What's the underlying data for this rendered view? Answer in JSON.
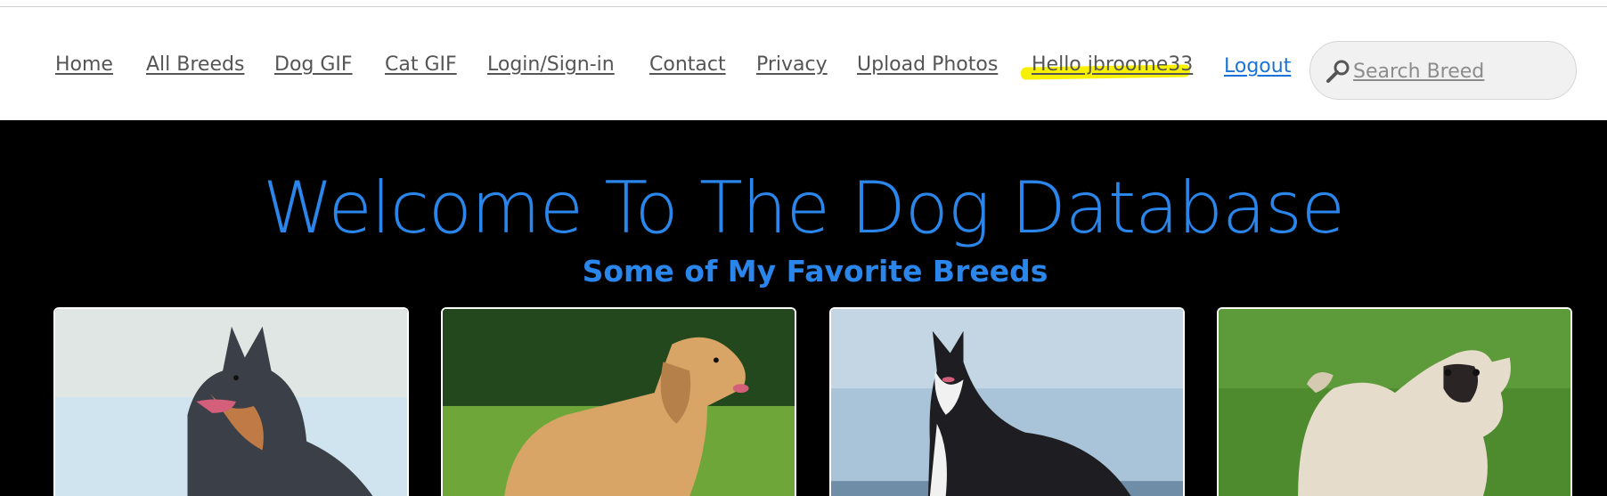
{
  "nav": {
    "links": [
      "Home",
      "All Breeds",
      "Dog GIF",
      "Cat GIF",
      "Login/Sign-in",
      "Contact",
      "Privacy",
      "Upload Photos"
    ],
    "greeting": "Hello jbroome33",
    "logout": "Logout",
    "search_placeholder": "Search Breed"
  },
  "hero": {
    "title": "Welcome To The Dog Database",
    "subtitle": "Some of My Favorite Breeds"
  },
  "breeds": [
    {
      "icon": "australian-cattle-dog-photo"
    },
    {
      "icon": "golden-retriever-photo"
    },
    {
      "icon": "siberian-husky-photo"
    },
    {
      "icon": "pug-photo"
    }
  ],
  "colors": {
    "accent": "#2a86ea",
    "logout": "#1a73d9",
    "highlight": "#f7f000",
    "hero_bg": "#000000"
  }
}
